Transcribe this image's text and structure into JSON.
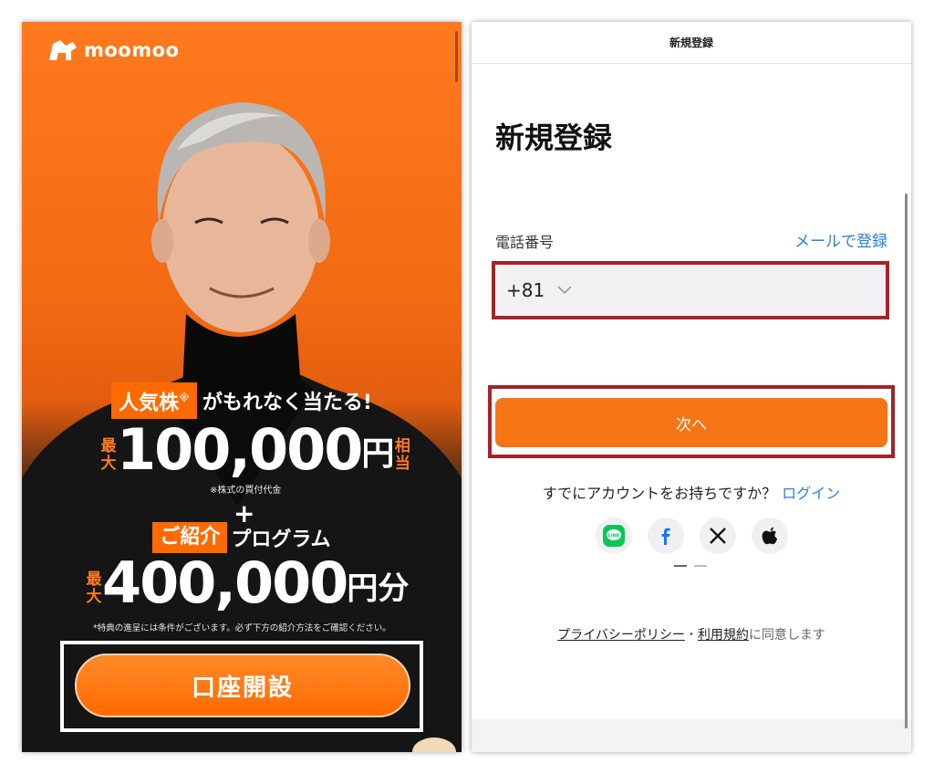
{
  "left": {
    "logo": {
      "text": "moomoo"
    },
    "tag1": {
      "highlight": "人気株",
      "mark": "※",
      "rest": "がもれなく当たる!"
    },
    "amount1": {
      "prefix": "最大",
      "value": "100,000",
      "unit": "円",
      "suffix": "相当"
    },
    "note1": "※株式の買付代金",
    "plus": "+",
    "tag2": {
      "highlight": "ご紹介",
      "rest": "プログラム"
    },
    "amount2": {
      "prefix": "最大",
      "value": "400,000",
      "unit": "円分"
    },
    "note2": "*特典の進呈には条件がございます。必ず下方の紹介方法をご確認ください。",
    "cta_label": "口座開設"
  },
  "right": {
    "topbar_title": "新規登録",
    "page_title": "新規登録",
    "phone_label": "電話番号",
    "email_link": "メールで登録",
    "country_code": "+81",
    "next_label": "次へ",
    "have_account": "すでにアカウントをお持ちですか？",
    "login_link": "ログイン",
    "socials": [
      "line-icon",
      "facebook-icon",
      "x-icon",
      "apple-icon"
    ],
    "legal": {
      "privacy": "プライバシーポリシー",
      "sep": "・",
      "terms": "利用規約",
      "agree": "に同意します"
    }
  },
  "colors": {
    "brand_orange": "#ff6a00",
    "button_orange": "#f57414",
    "link_blue": "#2e7fd6",
    "highlight_frame": "#a3242a"
  }
}
